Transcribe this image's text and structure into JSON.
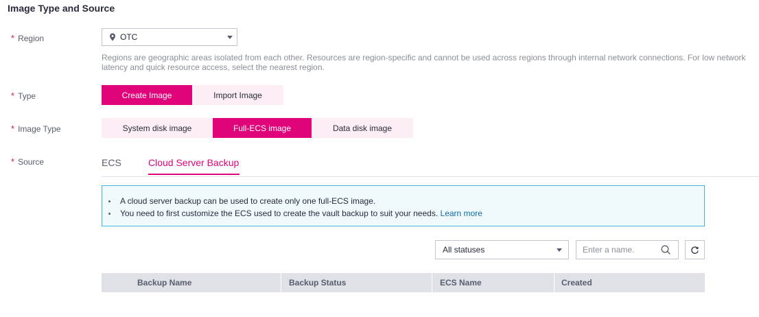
{
  "section": {
    "title": "Image Type and Source"
  },
  "required_mark": "*",
  "region": {
    "label": "Region",
    "value": "OTC",
    "help": "Regions are geographic areas isolated from each other. Resources are region-specific and cannot be used across regions through internal network connections. For low network latency and quick resource access, select the nearest region."
  },
  "type": {
    "label": "Type",
    "options": [
      "Create Image",
      "Import Image"
    ],
    "selected": "Create Image"
  },
  "image_type": {
    "label": "Image Type",
    "options": [
      "System disk image",
      "Full-ECS image",
      "Data disk image"
    ],
    "selected": "Full-ECS image"
  },
  "source": {
    "label": "Source",
    "tabs": [
      "ECS",
      "Cloud Server Backup"
    ],
    "active_tab": "Cloud Server Backup"
  },
  "notice": {
    "line1": "A cloud server backup can be used to create only one full-ECS image.",
    "line2": "You need to first customize the ECS used to create the vault backup to suit your needs.",
    "link": "Learn more"
  },
  "filter": {
    "status_value": "All statuses",
    "search_placeholder": "Enter a name."
  },
  "table": {
    "columns": [
      "Backup Name",
      "Backup Status",
      "ECS Name",
      "Created"
    ]
  },
  "colors": {
    "accent": "#e0037a",
    "accent_light": "#fdeef5",
    "required": "#e1165d",
    "link": "#0b6aa8",
    "notice_border": "#3db8d8"
  },
  "icons": [
    "location-pin-icon",
    "chevron-down-icon",
    "search-icon",
    "refresh-icon"
  ]
}
